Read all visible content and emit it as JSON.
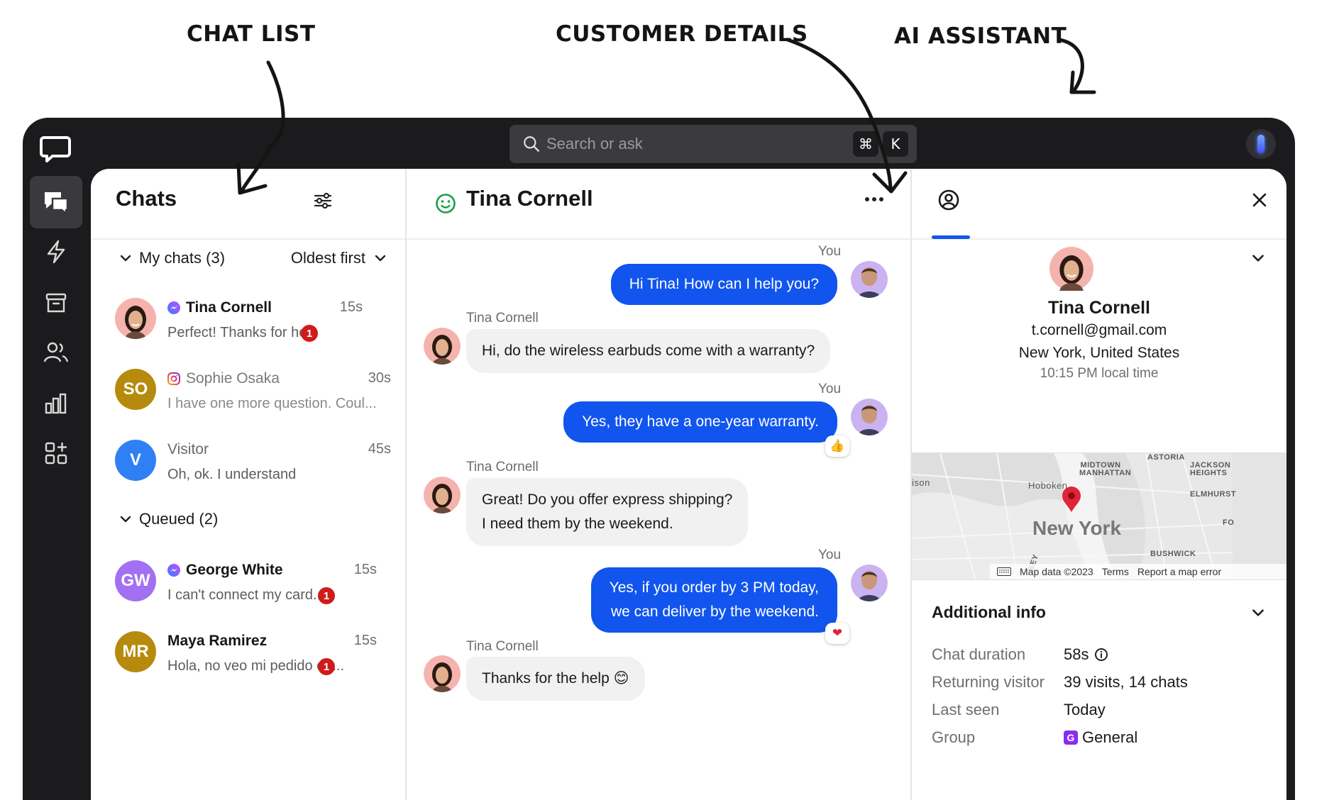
{
  "annotations": {
    "chat_list": "CHAT LIST",
    "customer_details": "CUSTOMER DETAILS",
    "ai_assistant": "AI ASSISTANT"
  },
  "colors": {
    "accent": "#1155ee",
    "badge": "#d01b1b",
    "frame": "#1b1b1d"
  },
  "topbar": {
    "search_placeholder": "Search or ask",
    "shortcut_keys": [
      "⌘",
      "K"
    ]
  },
  "sidebar": {
    "icons": [
      "logo-chat-icon",
      "chats-icon",
      "automations-bolt-icon",
      "archive-icon",
      "team-icon",
      "reports-icon",
      "apps-icon"
    ],
    "active": "chats-icon"
  },
  "chat_list": {
    "title": "Chats",
    "my_chats": {
      "label": "My chats (3)",
      "sort": "Oldest first"
    },
    "queued": {
      "label": "Queued (2)"
    },
    "items": [
      {
        "name": "Tina Cornell",
        "time": "15s",
        "preview": "Perfect! Thanks for he...",
        "unread": "1",
        "channel": "messenger",
        "avatar": "photo"
      },
      {
        "name": "Sophie Osaka",
        "time": "30s",
        "preview": "I have one more question. Coul...",
        "channel": "instagram",
        "initials": "SO",
        "avatar_color": "#b68a0c"
      },
      {
        "name": "Visitor",
        "time": "45s",
        "preview": "Oh, ok. I understand",
        "initials": "V",
        "avatar_color": "#2f80f5"
      },
      {
        "name": "George White",
        "time": "15s",
        "preview": "I can't connect my card...",
        "unread": "1",
        "channel": "messenger",
        "initials": "GW",
        "avatar_color": "#a270f2"
      },
      {
        "name": "Maya Ramirez",
        "time": "15s",
        "preview": "Hola, no veo mi pedido en...",
        "unread": "1",
        "initials": "MR",
        "avatar_color": "#b68a0c"
      }
    ]
  },
  "conversation": {
    "contact_name": "Tina Cornell",
    "messages": [
      {
        "from": "You",
        "text": [
          "Hi Tina! How can I help you?"
        ]
      },
      {
        "from": "Tina Cornell",
        "text": [
          "Hi, do the wireless earbuds come with a warranty?"
        ]
      },
      {
        "from": "You",
        "text": [
          "Yes, they have a one-year warranty."
        ],
        "reaction": "👍"
      },
      {
        "from": "Tina Cornell",
        "text": [
          "Great! Do you offer express shipping?",
          "I need them by the weekend."
        ]
      },
      {
        "from": "You",
        "text": [
          "Yes, if you order by 3 PM today,",
          "we can deliver by the weekend."
        ],
        "reaction": "❤"
      },
      {
        "from": "Tina Cornell",
        "text": [
          "Thanks for the help 😊"
        ]
      }
    ]
  },
  "details": {
    "name": "Tina Cornell",
    "email": "t.cornell@gmail.com",
    "location": "New York, United States",
    "local_time": "10:15 PM local time",
    "map": {
      "city": "New York",
      "labels": [
        "ASTORIA",
        "MIDTOWN MANHATTAN",
        "JACKSON HEIGHTS",
        "Hoboken",
        "ELMHURST",
        "BUSHWICK",
        "ison",
        "FO",
        "SEY"
      ],
      "attribution": "Map data ©2023",
      "terms": "Terms",
      "report": "Report a map error"
    },
    "additional_info": {
      "title": "Additional info",
      "rows": [
        {
          "label": "Chat duration",
          "value": "58s"
        },
        {
          "label": "Returning visitor",
          "value": "39 visits, 14 chats"
        },
        {
          "label": "Last seen",
          "value": "Today"
        },
        {
          "label": "Group",
          "value": "General",
          "group_letter": "G"
        }
      ]
    }
  }
}
